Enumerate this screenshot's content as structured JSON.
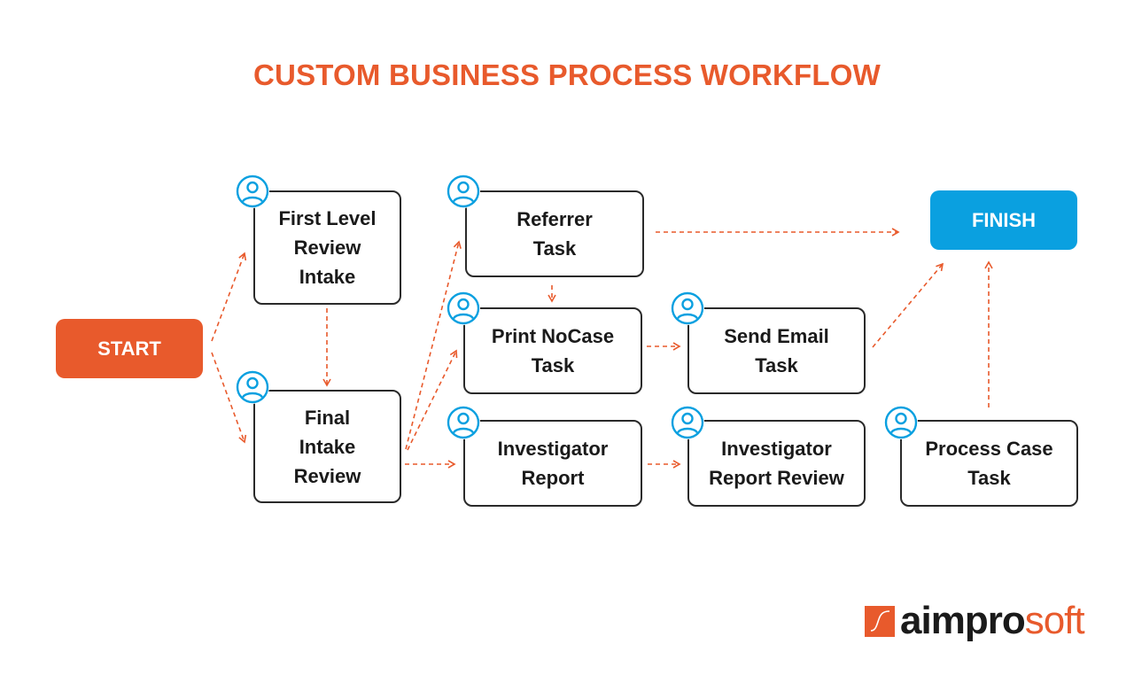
{
  "title": "CUSTOM BUSINESS PROCESS WORKFLOW",
  "colors": {
    "accent_orange": "#E85A2C",
    "accent_blue": "#0AA0E0",
    "box_border": "#2a2a2a",
    "text_dark": "#1a1a1a"
  },
  "nodes": {
    "start": {
      "label": "START",
      "type": "terminal"
    },
    "finish": {
      "label": "FINISH",
      "type": "terminal"
    },
    "first_level_review_intake": {
      "label": "First Level\nReview\nIntake",
      "icon": "user-icon"
    },
    "final_intake_review": {
      "label": "Final\nIntake\nReview",
      "icon": "user-icon"
    },
    "referrer_task": {
      "label": "Referrer\nTask",
      "icon": "user-icon"
    },
    "print_nocase_task": {
      "label": "Print NoCase\nTask",
      "icon": "user-icon"
    },
    "investigator_report": {
      "label": "Investigator\nReport",
      "icon": "user-icon"
    },
    "send_email_task": {
      "label": "Send Email\nTask",
      "icon": "user-icon"
    },
    "investigator_report_review": {
      "label": "Investigator\nReport Review",
      "icon": "user-icon"
    },
    "process_case_task": {
      "label": "Process Case\nTask",
      "icon": "user-icon"
    }
  },
  "edges": [
    {
      "from": "start",
      "to": "first_level_review_intake",
      "style": "dashed-arrow"
    },
    {
      "from": "start",
      "to": "final_intake_review",
      "style": "dashed-arrow"
    },
    {
      "from": "first_level_review_intake",
      "to": "final_intake_review",
      "style": "dashed-arrow"
    },
    {
      "from": "final_intake_review",
      "to": "referrer_task",
      "style": "dashed-arrow"
    },
    {
      "from": "final_intake_review",
      "to": "print_nocase_task",
      "style": "dashed-arrow"
    },
    {
      "from": "final_intake_review",
      "to": "investigator_report",
      "style": "dashed-arrow"
    },
    {
      "from": "referrer_task",
      "to": "print_nocase_task",
      "style": "dashed-arrow"
    },
    {
      "from": "referrer_task",
      "to": "finish",
      "style": "dashed-arrow"
    },
    {
      "from": "print_nocase_task",
      "to": "send_email_task",
      "style": "dashed-arrow"
    },
    {
      "from": "send_email_task",
      "to": "finish",
      "style": "dashed-arrow"
    },
    {
      "from": "investigator_report",
      "to": "investigator_report_review",
      "style": "dashed-arrow"
    },
    {
      "from": "process_case_task",
      "to": "finish",
      "style": "dashed-arrow"
    }
  ],
  "logo": {
    "dark_part": "aimpro",
    "accent_part": "soft",
    "icon": "aimprosoft-logo-mark"
  }
}
